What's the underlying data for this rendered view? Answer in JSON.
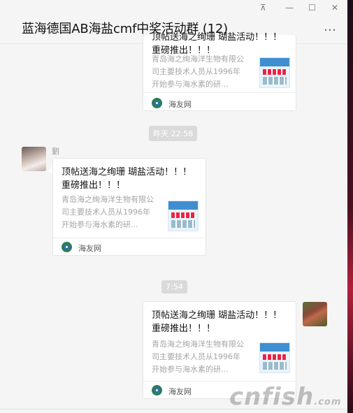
{
  "window": {
    "title": "蓝海德国AB海盐cmf中奖活动群 (12)",
    "more_icon": "more-dots-icon"
  },
  "timestamps": [
    "昨天 22:58",
    "7:54"
  ],
  "messages": [
    {
      "sender": "",
      "card": {
        "title": "顶帖送海之绚珊 瑚盐活动！！！重磅推出！！！",
        "desc": "青岛海之绚海洋生物有限公司主要技术人员从1996年开始参与海水素的研...",
        "source": "海友网"
      }
    },
    {
      "sender": "劉",
      "card": {
        "title": "顶帖送海之绚珊 瑚盐活动！！！重磅推出！！！",
        "desc": "青岛海之绚海洋生物有限公司主要技术人员从1996年开始参与海水素的研...",
        "source": "海友网"
      }
    },
    {
      "sender": "",
      "card": {
        "title": "顶帖送海之绚珊 瑚盐活动！！！重磅推出！！！",
        "desc": "青岛海之绚海洋生物有限公司主要技术人员从1996年开始参与海水素的研...",
        "source": "海友网"
      }
    }
  ],
  "watermark": {
    "text": "cnfish",
    "suffix": ".com"
  }
}
